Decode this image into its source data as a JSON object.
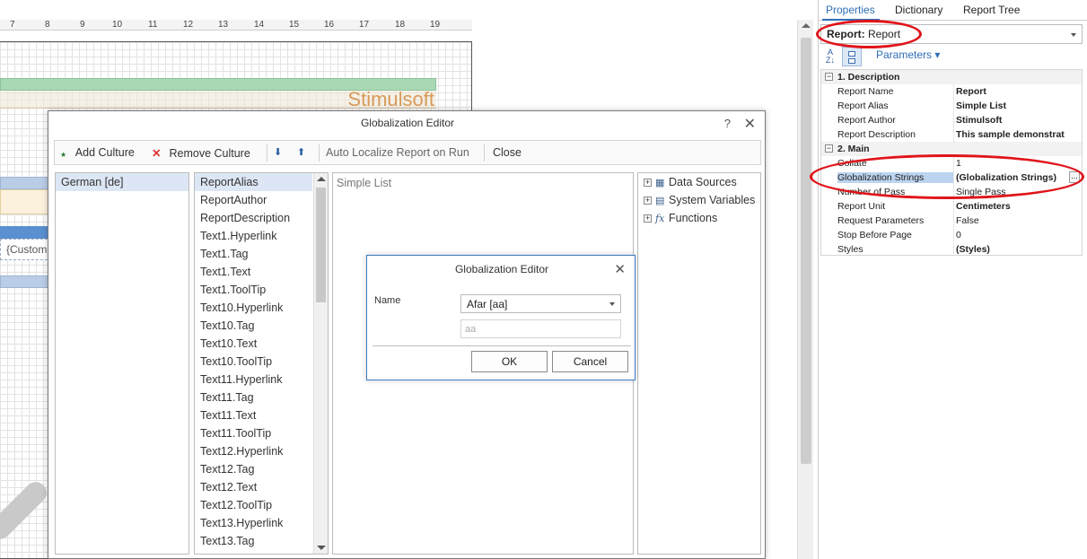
{
  "ruler": {
    "ticks": [
      "7",
      "8",
      "9",
      "10",
      "11",
      "12",
      "13",
      "14",
      "15",
      "16",
      "17",
      "18",
      "19"
    ]
  },
  "canvas": {
    "stimulsoft_text": "Stimulsoft",
    "custom_text": "{Custom"
  },
  "properties_panel": {
    "tabs": [
      "Properties",
      "Dictionary",
      "Report Tree"
    ],
    "active_tab": "Properties",
    "object_selector": {
      "bold": "Report:",
      "value": "Report"
    },
    "parameters_label": "Parameters",
    "categories": [
      {
        "title": "1. Description",
        "rows": [
          {
            "key": "Report Name",
            "value": "Report"
          },
          {
            "key": "Report Alias",
            "value": "Simple List"
          },
          {
            "key": "Report Author",
            "value": "Stimulsoft"
          },
          {
            "key": "Report Description",
            "value": "This sample demonstrat"
          }
        ]
      },
      {
        "title": "2. Main",
        "rows": [
          {
            "key": "Collate",
            "value": "1"
          },
          {
            "key": "Globalization Strings",
            "value": "(Globalization Strings)",
            "ellipsis": "..."
          },
          {
            "key": "Number of Pass",
            "value": "Single Pass"
          },
          {
            "key": "Report Unit",
            "value": "Centimeters"
          },
          {
            "key": "Request Parameters",
            "value": "False"
          },
          {
            "key": "Stop Before Page",
            "value": "0"
          },
          {
            "key": "Styles",
            "value": "(Styles)"
          }
        ]
      }
    ],
    "highlight_color": "#e0141a"
  },
  "globalization_editor": {
    "title": "Globalization Editor",
    "help": "?",
    "close": "✕",
    "toolbar": {
      "add_culture": "Add Culture",
      "remove_culture": "Remove Culture",
      "auto_localize": "Auto Localize Report on Run",
      "close": "Close"
    },
    "cultures": [
      "German [de]"
    ],
    "items": [
      "ReportAlias",
      "ReportAuthor",
      "ReportDescription",
      "Text1.Hyperlink",
      "Text1.Tag",
      "Text1.Text",
      "Text1.ToolTip",
      "Text10.Hyperlink",
      "Text10.Tag",
      "Text10.Text",
      "Text10.ToolTip",
      "Text11.Hyperlink",
      "Text11.Tag",
      "Text11.Text",
      "Text11.ToolTip",
      "Text12.Hyperlink",
      "Text12.Tag",
      "Text12.Text",
      "Text12.ToolTip",
      "Text13.Hyperlink",
      "Text13.Tag"
    ],
    "value_text": "Simple List",
    "tree": [
      {
        "label": "Data Sources",
        "icon": "table-icon"
      },
      {
        "label": "System Variables",
        "icon": "variables-icon"
      },
      {
        "label": "Functions",
        "icon": "fx-icon"
      }
    ]
  },
  "culture_dialog": {
    "title": "Globalization Editor",
    "close": "✕",
    "name_label": "Name",
    "selected_culture": "Afar [aa]",
    "code_value": "aa",
    "ok": "OK",
    "cancel": "Cancel"
  }
}
